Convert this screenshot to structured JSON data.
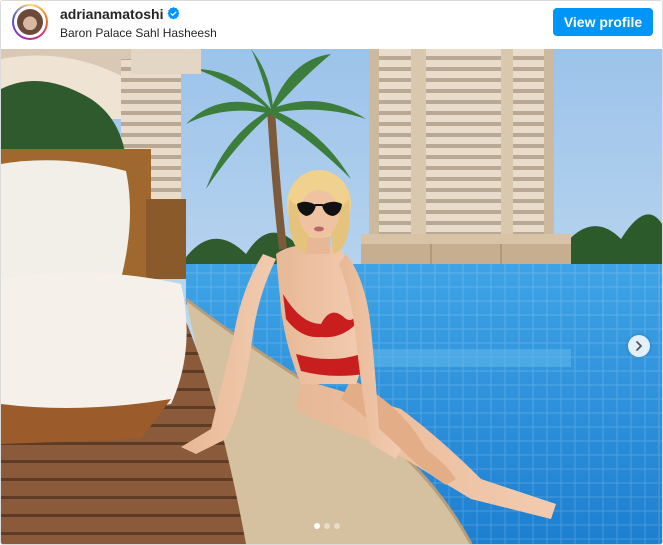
{
  "post": {
    "username": "adrianamatoshi",
    "verified": true,
    "location": "Baron Palace Sahl Hasheesh",
    "view_profile_label": "View profile"
  },
  "carousel": {
    "slide_count": 3,
    "active_slide": 1
  },
  "icons": {
    "verified": "verified-badge-icon",
    "next": "chevron-right-icon"
  },
  "colors": {
    "accent": "#0095f6",
    "username": "#262626"
  }
}
